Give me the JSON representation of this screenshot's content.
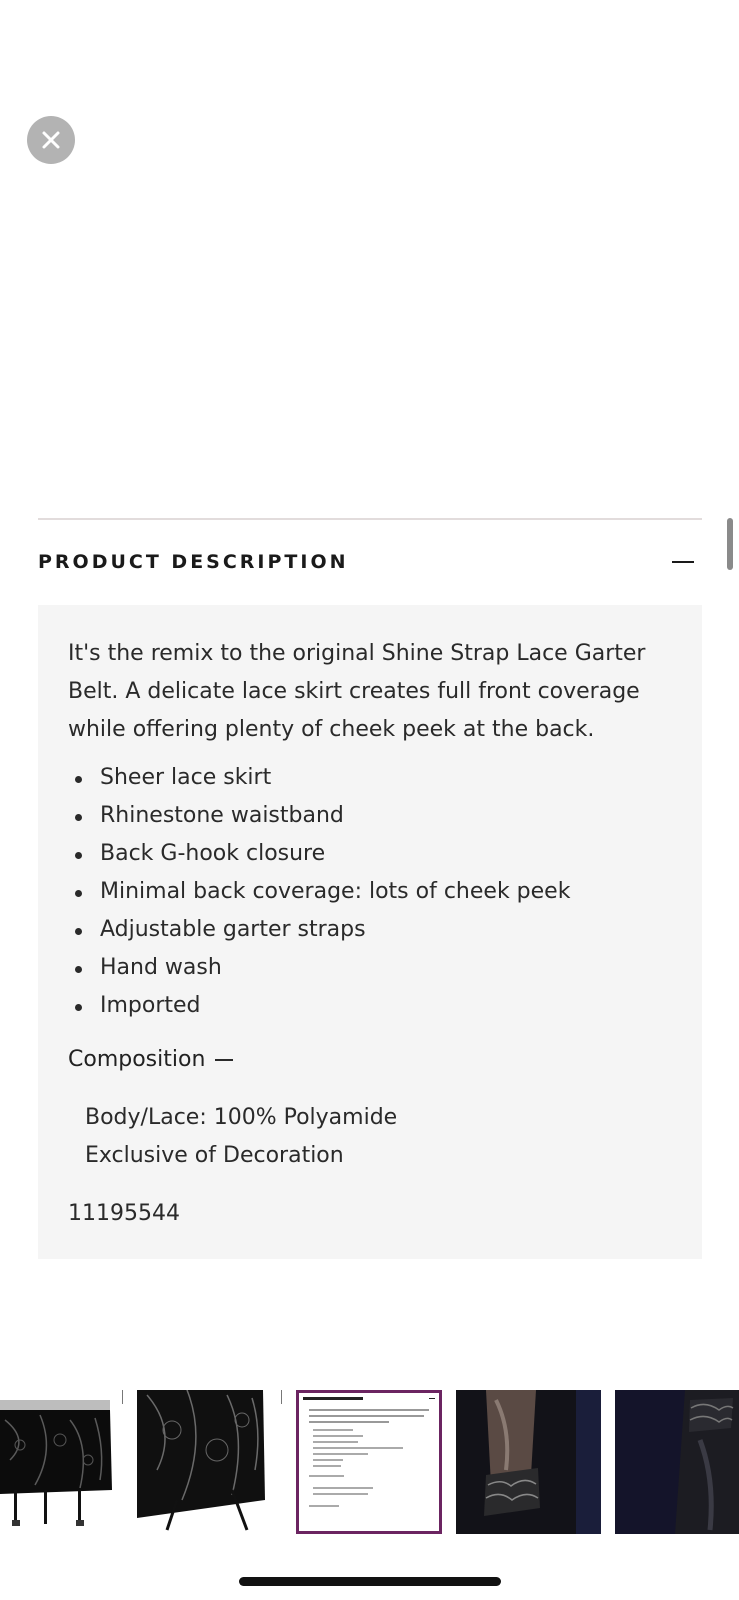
{
  "description": {
    "heading": "PRODUCT DESCRIPTION",
    "intro": "It's the remix to the original Shine Strap Lace Garter Belt. A delicate lace skirt creates full front coverage while offering plenty of cheek peek at the back.",
    "features": [
      "Sheer lace skirt",
      "Rhinestone waistband",
      "Back G-hook closure",
      "Minimal back coverage: lots of cheek peek",
      "Adjustable garter straps",
      "Hand wash",
      "Imported"
    ],
    "composition_label": "Composition",
    "composition_lines": [
      "Body/Lace: 100% Polyamide",
      "Exclusive of Decoration"
    ],
    "style_number": "11195544"
  },
  "thumbnails": [
    {
      "name": "garter-belt-front"
    },
    {
      "name": "garter-belt-lace-detail"
    },
    {
      "name": "product-description-card"
    },
    {
      "name": "stockings-lace-top"
    },
    {
      "name": "stockings-dark"
    }
  ],
  "colors": {
    "panel_bg": "#f5f5f5",
    "selected_thumb_border": "#6b2461",
    "close_button_bg": "#b3b3b3"
  }
}
